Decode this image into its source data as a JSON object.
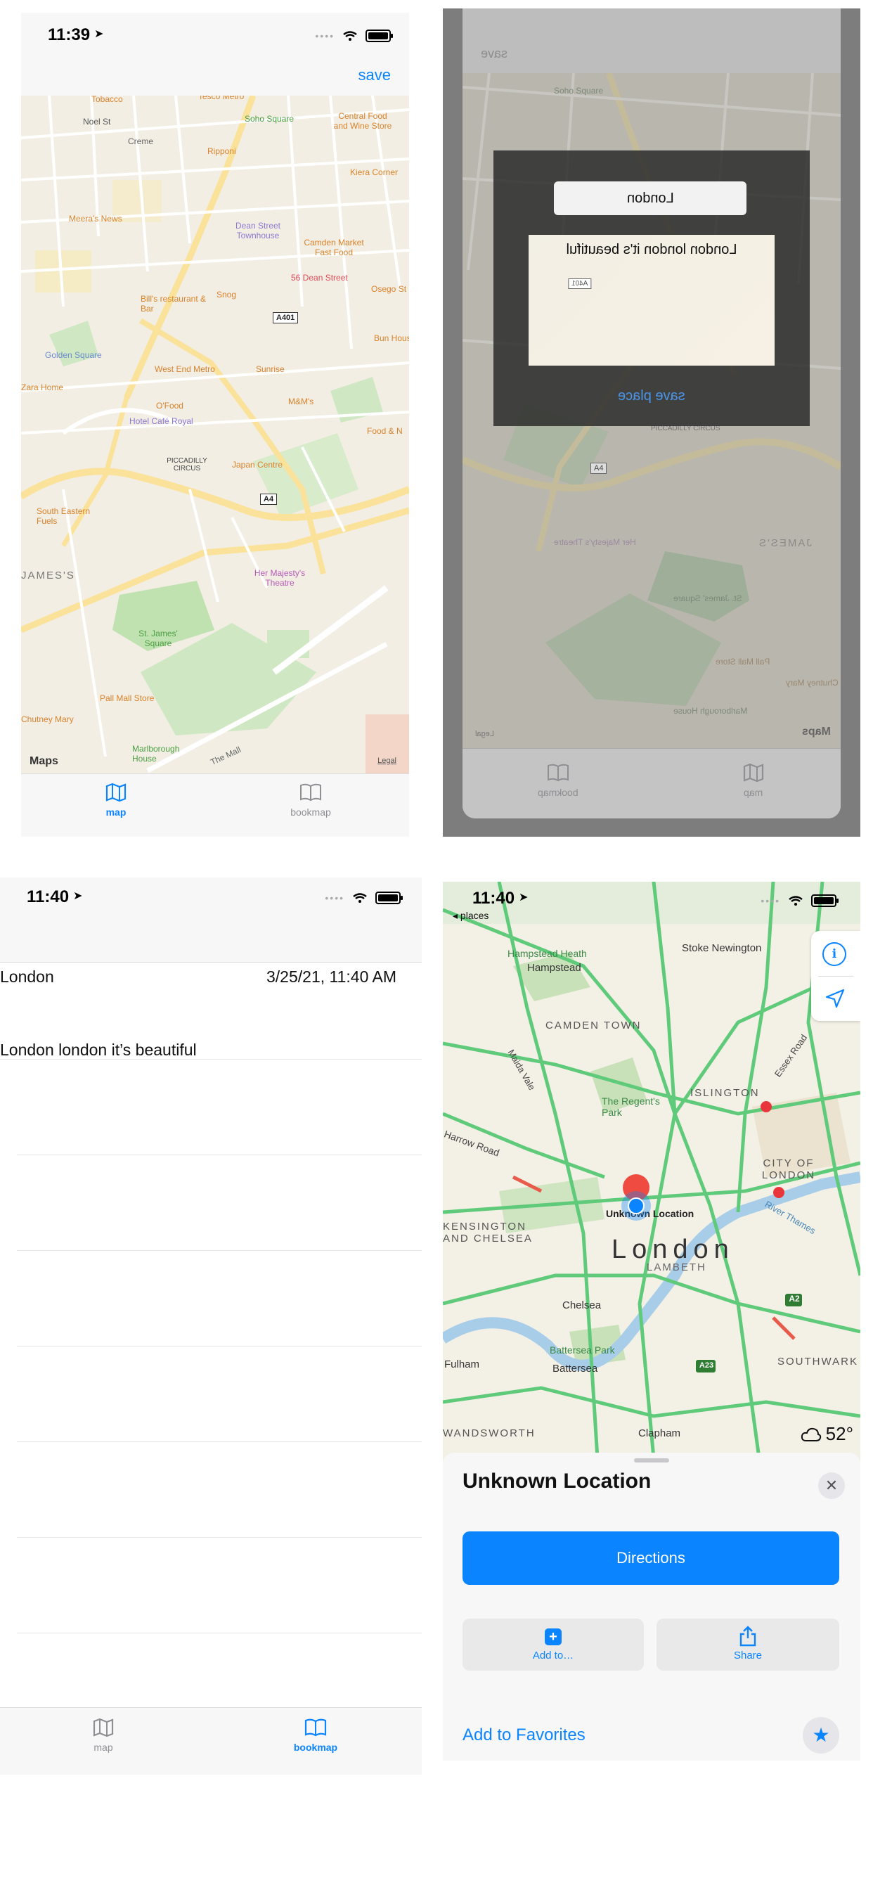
{
  "panel1": {
    "status_time": "11:39",
    "save_label": "save",
    "map_labels": [
      "Tobacco",
      "Tesco Metro",
      "Soho Square",
      "Noel St",
      "Creme",
      "Central Food and Wine Store",
      "Ripponi",
      "Kiera Corner",
      "Meera's News",
      "Dean Street Townhouse",
      "Camden Market Fast Food",
      "56 Dean Street",
      "Osego St",
      "Bill's restaurant & Bar",
      "Snog",
      "Golden Square",
      "A401",
      "Bun House",
      "West End Metro",
      "Sunrise",
      "Zara Home",
      "O'Food",
      "M&M's",
      "Hotel Café Royal",
      "Food & N",
      "PICCADILLY CIRCUS",
      "Japan Centre",
      "South Eastern Fuels",
      "A4",
      "JAMES'S",
      "Her Majesty's Theatre",
      "St. James' Square",
      "Pall Mall Store",
      "Chutney Mary",
      "Marlborough House",
      "The Mall",
      "Maps",
      "Legal"
    ],
    "tabs": [
      {
        "label": "map"
      },
      {
        "label": "bookmap"
      }
    ]
  },
  "panel2": {
    "top_hint": "save",
    "name_value": "London",
    "description_value": "London london it's beautiful",
    "map_chip": "A401",
    "save_place_label": "save place",
    "bg_labels": [
      "Soho Square",
      "PICCADILLY CIRCUS",
      "JAMES'S",
      "Her Majesty's Theatre",
      "St. James' Square",
      "Pall Mall Store",
      "Chutney Mary",
      "Marlborough House",
      "A4",
      "Maps",
      "Legal"
    ],
    "tabs": [
      {
        "label": "bookmap"
      },
      {
        "label": "map"
      }
    ]
  },
  "panel3": {
    "status_time": "11:40",
    "entry": {
      "title": "London",
      "date": "3/25/21, 11:40 AM",
      "description": "London london it’s beautiful"
    },
    "tabs": [
      {
        "label": "map"
      },
      {
        "label": "bookmap"
      }
    ]
  },
  "panel4": {
    "status_time": "11:40",
    "back_label": "◂ places",
    "map_labels": [
      "Hampstead Heath",
      "Hampstead",
      "Stoke Newington",
      "CAMDEN TOWN",
      "ISLINGTON",
      "The Regent's Park",
      "Harrow Road",
      "CITY OF LONDON",
      "Unknown Location",
      "River Thames",
      "KENSINGTON AND CHELSEA",
      "London",
      "LAMBETH",
      "A2",
      "Chelsea",
      "Battersea Park",
      "Fulham",
      "Battersea",
      "A23",
      "SOUTHWARK",
      "WANDSWORTH",
      "Clapham",
      "Maida Vale",
      "Essex Road"
    ],
    "weather": "52°",
    "sheet": {
      "title": "Unknown Location",
      "directions_label": "Directions",
      "add_to_label": "Add to…",
      "share_label": "Share",
      "favorites_label": "Add to Favorites"
    },
    "accent": "#0a84ff"
  }
}
